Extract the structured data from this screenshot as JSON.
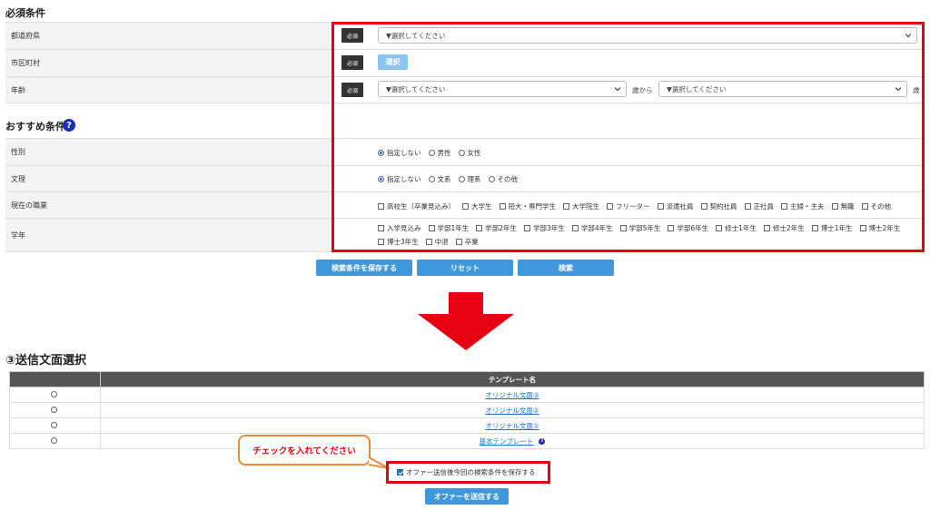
{
  "required_section": {
    "title": "必須条件",
    "badge": "必須",
    "rows": [
      {
        "label": "都道府県",
        "select_value": "▼選択してください"
      },
      {
        "label": "市区町村",
        "button_label": "選択"
      },
      {
        "label": "年齢",
        "select_from": "▼選択してください",
        "from_suffix": "歳から",
        "select_to": "▼選択してください",
        "to_suffix": "歳"
      }
    ]
  },
  "recommended_section": {
    "title": "おすすめ条件",
    "help_icon_text": "?",
    "gender": {
      "label": "性別",
      "options": [
        "指定しない",
        "男性",
        "女性"
      ],
      "selected": 0
    },
    "humanities": {
      "label": "文理",
      "options": [
        "指定しない",
        "文系",
        "理系",
        "その他"
      ],
      "selected": 0
    },
    "occupation": {
      "label": "現在の職業",
      "options": [
        "高校生（卒業見込み）",
        "大学生",
        "短大・専門学生",
        "大学院生",
        "フリーター",
        "派遣社員",
        "契約社員",
        "正社員",
        "主婦・主夫",
        "無職",
        "その他"
      ]
    },
    "grade": {
      "label": "学年",
      "options": [
        "入学見込み",
        "学部1年生",
        "学部2年生",
        "学部3年生",
        "学部4年生",
        "学部5年生",
        "学部6年生",
        "修士1年生",
        "修士2年生",
        "博士1年生",
        "博士2年生",
        "博士3年生",
        "中退",
        "卒業"
      ]
    }
  },
  "actions": {
    "save_label": "検索条件を保存する",
    "reset_label": "リセット",
    "search_label": "検索"
  },
  "template_section": {
    "title": "③送信文面選択",
    "column_header": "テンプレート名",
    "rows": [
      {
        "name": "オリジナル文面③"
      },
      {
        "name": "オリジナル文面②"
      },
      {
        "name": "オリジナル文面①"
      },
      {
        "name": "基本テンプレート",
        "info_icon": "i"
      }
    ]
  },
  "callout_text": "チェックを入れてください",
  "save_condition_checkbox": {
    "label": "オファー送信後今回の検索条件を保存する",
    "checked": true
  },
  "send_button_label": "オファーを送信する",
  "colors": {
    "highlight": "#e60012",
    "arrow": "#e60012",
    "primary_button": "#3f97dc",
    "callout_border": "#e88c3c"
  }
}
